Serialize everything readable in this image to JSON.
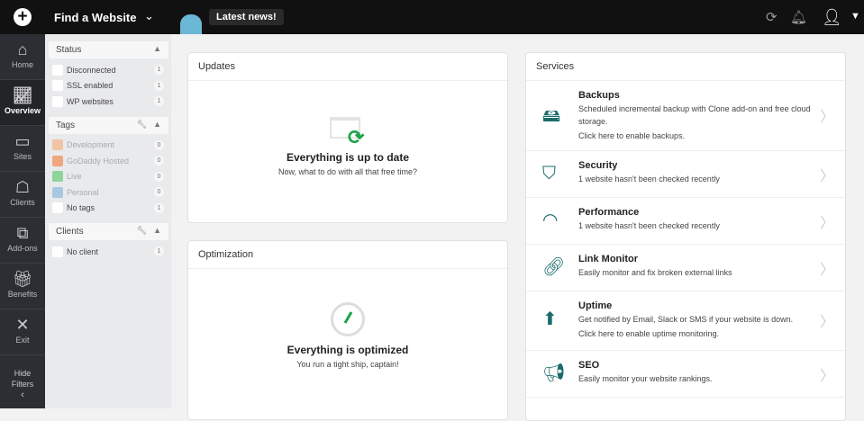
{
  "topbar": {
    "find_label": "Find a Website",
    "news_label": "Latest news!"
  },
  "nav": [
    {
      "label": "Home",
      "icon": "home-icon"
    },
    {
      "label": "Overview",
      "icon": "chart-icon"
    },
    {
      "label": "Sites",
      "icon": "sites-icon"
    },
    {
      "label": "Clients",
      "icon": "clients-icon"
    },
    {
      "label": "Add-ons",
      "icon": "puzzle-icon"
    },
    {
      "label": "Benefits",
      "icon": "gift-icon"
    },
    {
      "label": "Exit",
      "icon": "close-icon"
    }
  ],
  "hide_filters": {
    "line1": "Hide",
    "line2": "Filters"
  },
  "filters": {
    "status": {
      "title": "Status",
      "items": [
        {
          "label": "Disconnected",
          "count": "1"
        },
        {
          "label": "SSL enabled",
          "count": "1"
        },
        {
          "label": "WP websites",
          "count": "1"
        }
      ]
    },
    "tags": {
      "title": "Tags",
      "items": [
        {
          "label": "Development",
          "count": "0",
          "color": "#f0c4a4"
        },
        {
          "label": "GoDaddy Hosted",
          "count": "0",
          "color": "#eea77e"
        },
        {
          "label": "Live",
          "count": "0",
          "color": "#8fd49a"
        },
        {
          "label": "Personal",
          "count": "0",
          "color": "#a8c8e2"
        },
        {
          "label": "No tags",
          "count": "1"
        }
      ]
    },
    "clients": {
      "title": "Clients",
      "items": [
        {
          "label": "No client",
          "count": "1"
        }
      ]
    }
  },
  "updates": {
    "title": "Updates",
    "heading": "Everything is up to date",
    "sub": "Now, what to do with all that free time?"
  },
  "optimization": {
    "title": "Optimization",
    "heading": "Everything is optimized",
    "sub": "You run a tight ship, captain!"
  },
  "services": {
    "title": "Services",
    "items": [
      {
        "title": "Backups",
        "desc": "Scheduled incremental backup with Clone add-on and free cloud storage.",
        "link": "Click here to enable backups."
      },
      {
        "title": "Security",
        "desc": "1 website hasn't been checked recently"
      },
      {
        "title": "Performance",
        "desc": "1 website hasn't been checked recently"
      },
      {
        "title": "Link Monitor",
        "desc": "Easily monitor and fix broken external links"
      },
      {
        "title": "Uptime",
        "desc": "Get notified by Email, Slack or SMS if your website is down.",
        "link": "Click here to enable uptime monitoring."
      },
      {
        "title": "SEO",
        "desc": "Easily monitor your website rankings."
      }
    ]
  }
}
